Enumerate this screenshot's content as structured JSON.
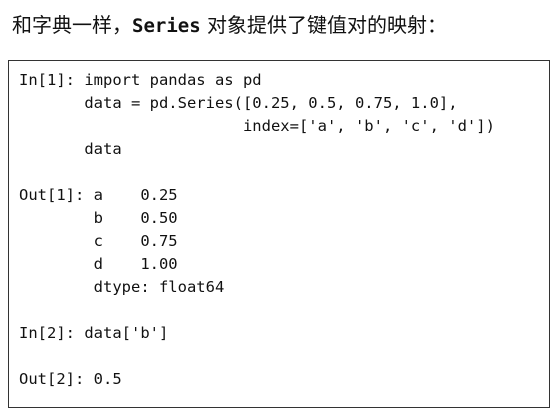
{
  "heading": {
    "before": "和字典一样，",
    "code": "Series",
    "after": " 对象提供了键值对的映射："
  },
  "code_lines": [
    "In[1]: import pandas as pd",
    "       data = pd.Series([0.25, 0.5, 0.75, 1.0],",
    "                        index=['a', 'b', 'c', 'd'])",
    "       data",
    "",
    "Out[1]: a    0.25",
    "        b    0.50",
    "        c    0.75",
    "        d    1.00",
    "        dtype: float64",
    "",
    "In[2]: data['b']",
    "",
    "Out[2]: 0.5"
  ]
}
